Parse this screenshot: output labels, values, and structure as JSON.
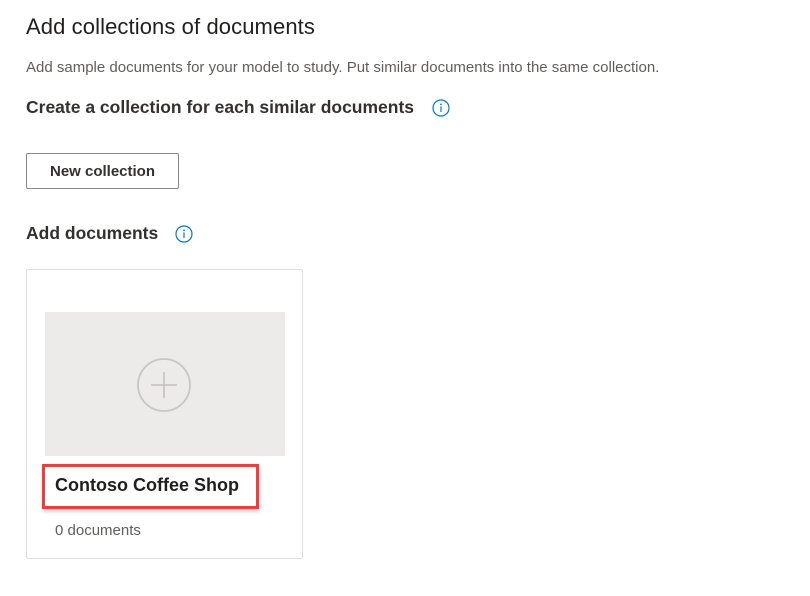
{
  "page": {
    "title": "Add collections of documents",
    "description": "Add sample documents for your model to study. Put similar documents into the same collection."
  },
  "collections_section": {
    "heading": "Create a collection for each similar documents",
    "info_icon": "info-icon",
    "new_collection_label": "New collection"
  },
  "documents_section": {
    "heading": "Add documents",
    "info_icon": "info-icon"
  },
  "collections": [
    {
      "name": "Contoso Coffee Shop",
      "count_text": "0 documents",
      "icon": "add-circle-icon",
      "highlighted": true
    }
  ],
  "colors": {
    "accent": "#0078d4",
    "highlight": "#e8403f",
    "preview_background": "#edebe9"
  }
}
